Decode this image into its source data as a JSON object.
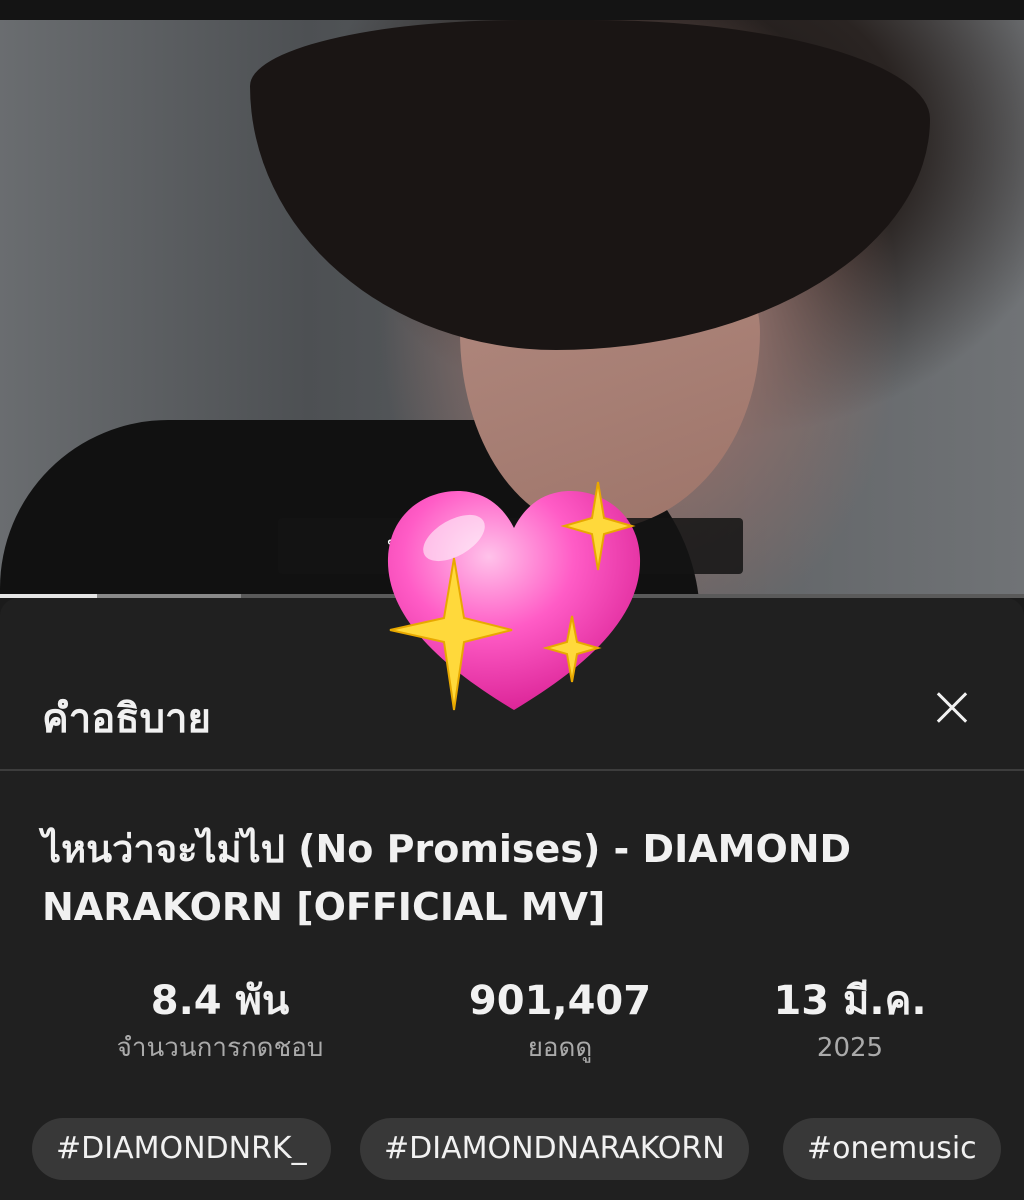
{
  "video": {
    "subtitle": "บอกว่าน... ...ันไปไหน",
    "progress_played": 0.095,
    "progress_buffered": 0.235
  },
  "description_panel": {
    "header_title": "คำอธิบาย",
    "close_icon": "close-icon",
    "video_title": "ไหนว่าจะไม่ไป (No Promises) - DIAMOND NARAKORN [OFFICIAL MV]",
    "stats": [
      {
        "value": "8.4 พัน",
        "label": "จำนวนการกดชอบ"
      },
      {
        "value": "901,407",
        "label": "ยอดดู"
      },
      {
        "value": "13 มี.ค.",
        "label": "2025"
      }
    ],
    "hashtags": [
      "#DIAMONDNRK_",
      "#DIAMONDNARAKORN",
      "#onemusic"
    ]
  },
  "overlay": {
    "sticker": "sparkling-heart-emoji"
  }
}
